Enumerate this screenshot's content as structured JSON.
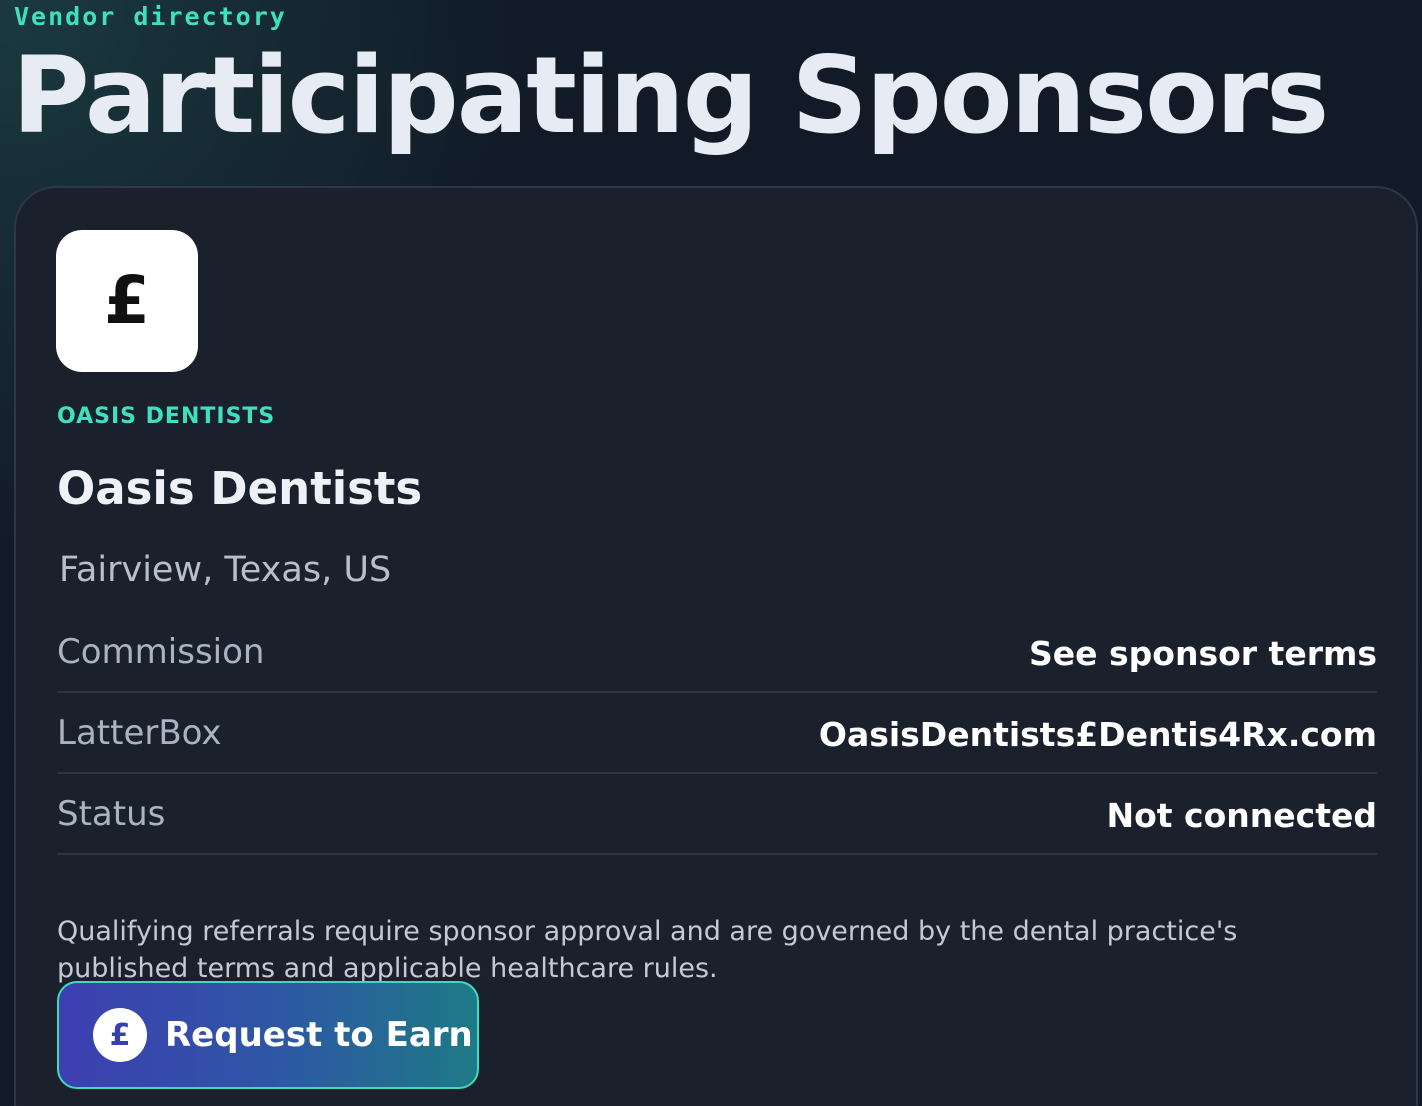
{
  "header": {
    "eyebrow": "Vendor directory",
    "title": "Participating Sponsors"
  },
  "sponsor": {
    "logo_glyph": "£",
    "tag": "OASIS DENTISTS",
    "name": "Oasis Dentists",
    "location": "Fairview, Texas, US",
    "details": [
      {
        "label": "Commission",
        "value": "See sponsor terms"
      },
      {
        "label": "LatterBox",
        "value": "OasisDentists£Dentis4Rx.com"
      },
      {
        "label": "Status",
        "value": "Not connected"
      }
    ],
    "disclaimer": "Qualifying referrals require sponsor approval and are governed by the dental practice's published terms and applicable healthcare rules.",
    "cta": {
      "icon_glyph": "£",
      "label": "Request to Earn"
    }
  },
  "colors": {
    "accent": "#3fe0c0",
    "background": "#121a26",
    "card": "#1b212c",
    "button_gradient_start": "#3d3fb0",
    "button_gradient_end": "#1e7a86"
  },
  "icons": {
    "logo": "pound-sign-icon",
    "cta": "pound-coin-icon"
  }
}
